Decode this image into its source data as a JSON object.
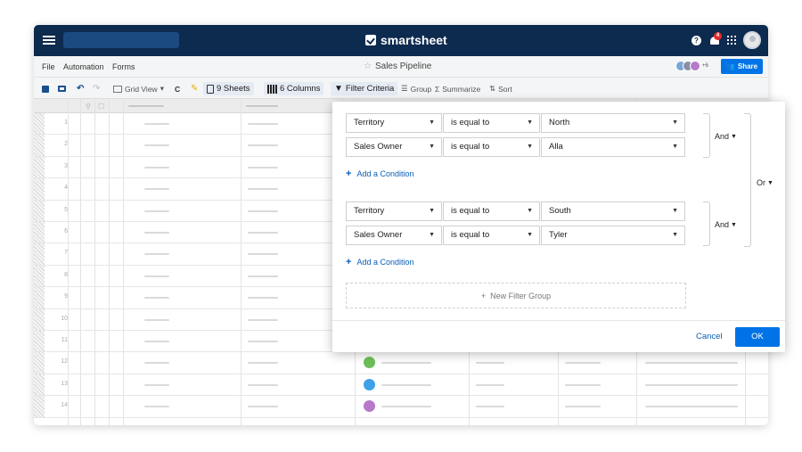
{
  "topbar": {
    "logo_text": "smartsheet",
    "notification_count": "4"
  },
  "menubar": {
    "items": [
      "File",
      "Automation",
      "Forms"
    ],
    "sheet_title": "Sales Pipeline",
    "collaborators_more": "+6",
    "share_label": "Share"
  },
  "toolbar": {
    "grid_view": "Grid View",
    "sheets": "9 Sheets",
    "columns": "6 Columns",
    "filter": "Filter Criteria",
    "group": "Group",
    "summarize": "Summarize",
    "sort": "Sort"
  },
  "grid": {
    "row_numbers": [
      "1",
      "2",
      "3",
      "4",
      "5",
      "6",
      "7",
      "8",
      "9",
      "10",
      "11",
      "12",
      "13",
      "14"
    ]
  },
  "filter": {
    "groups": [
      {
        "conditions": [
          {
            "field": "Territory",
            "operator": "is equal to",
            "value": "North"
          },
          {
            "field": "Sales Owner",
            "operator": "is equal to",
            "value": "Alla"
          }
        ],
        "joiner": "And"
      },
      {
        "conditions": [
          {
            "field": "Territory",
            "operator": "is equal to",
            "value": "South"
          },
          {
            "field": "Sales Owner",
            "operator": "is equal to",
            "value": "Tyler"
          }
        ],
        "joiner": "And"
      }
    ],
    "add_condition": "Add a Condition",
    "group_joiner": "Or",
    "new_group": "New Filter Group",
    "cancel": "Cancel",
    "ok": "OK"
  },
  "colors": {
    "navy": "#0d2a4f",
    "accent": "#0073e6",
    "link": "#0a5fb4"
  }
}
